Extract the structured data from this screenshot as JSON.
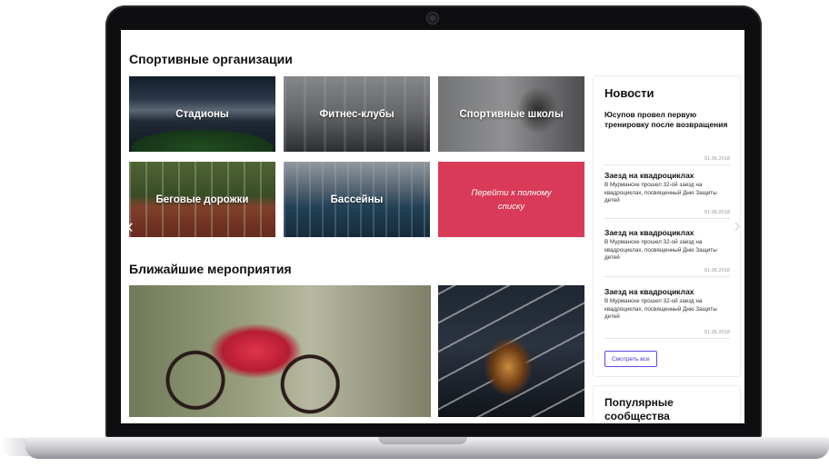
{
  "organizations": {
    "title": "Спортивные организации",
    "tiles": [
      {
        "label": "Стадионы"
      },
      {
        "label": "Фитнес-клубы"
      },
      {
        "label": "Спортивные школы"
      },
      {
        "label": "Беговые дорожки"
      },
      {
        "label": "Бассейны"
      }
    ],
    "cta_label": "Перейти к полному списку",
    "cta_color": "#d83a58"
  },
  "events": {
    "title": "Ближайшие мероприятия"
  },
  "news": {
    "heading": "Новости",
    "items": [
      {
        "title": "Юсупов провел первую тренировку после возвращения",
        "text": "",
        "date": "01.06.2018"
      },
      {
        "title": "Заезд на квадроциклах",
        "text": "В Мурманске прошел 32-ой заезд на квадроциклах, посвященный Дню Защиты детей",
        "date": "01.06.2018"
      },
      {
        "title": "Заезд на квадроциклах",
        "text": "В Мурманске прошел 32-ой заезд на квадроциклах, посвященный Дню Защиты детей",
        "date": "01.06.2018"
      },
      {
        "title": "Заезд на квадроциклах",
        "text": "В Мурманске прошел 32-ой заезд на квадроциклах, посвященный Дню Защиты детей",
        "date": "01.06.2018"
      }
    ],
    "see_all_label": "Смотреть все",
    "accent_color": "#5c4ee0"
  },
  "communities": {
    "heading": "Популярные сообщества"
  },
  "icons": {
    "prev": "chevron-left-icon",
    "next": "chevron-right-icon",
    "camera": "camera-icon"
  }
}
